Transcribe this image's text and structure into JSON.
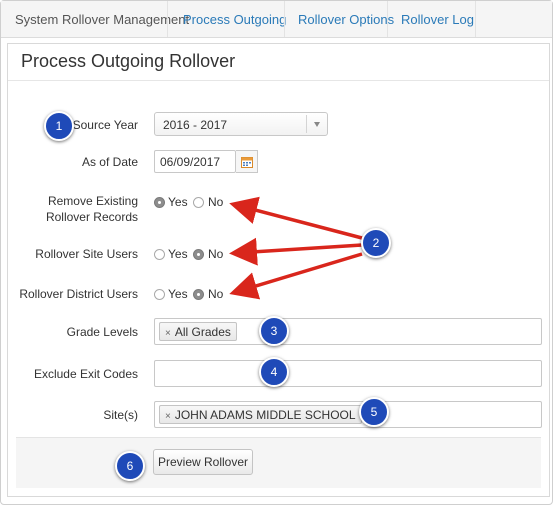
{
  "nav": {
    "title": "System Rollover Management",
    "tabs": [
      "Process Outgoing",
      "Rollover Options",
      "Rollover Log"
    ]
  },
  "page": {
    "title": "Process Outgoing Rollover"
  },
  "form": {
    "source_year": {
      "label": "Source Year",
      "value": "2016 - 2017"
    },
    "as_of_date": {
      "label": "As of Date",
      "value": "06/09/2017"
    },
    "remove_existing": {
      "label_line1": "Remove Existing",
      "label_line2": "Rollover Records",
      "yes": "Yes",
      "no": "No",
      "selected": "Yes"
    },
    "rollover_site_users": {
      "label": "Rollover Site Users",
      "yes": "Yes",
      "no": "No",
      "selected": "No"
    },
    "rollover_district_users": {
      "label": "Rollover District Users",
      "yes": "Yes",
      "no": "No",
      "selected": "No"
    },
    "grade_levels": {
      "label": "Grade Levels",
      "chips": [
        "All Grades"
      ]
    },
    "exclude_exit_codes": {
      "label": "Exclude Exit Codes",
      "chips": []
    },
    "sites": {
      "label": "Site(s)",
      "chips": [
        "JOHN ADAMS MIDDLE SCHOOL"
      ]
    }
  },
  "footer": {
    "preview_button": "Preview Rollover"
  },
  "annotations": {
    "badges": [
      "1",
      "2",
      "3",
      "4",
      "5",
      "6"
    ],
    "badge_color": "#1f4ab8",
    "arrow_color": "#d9261c"
  },
  "colors": {
    "link": "#2a7ab8",
    "nav_bg": "#f5f5f5"
  },
  "icons": {
    "chip_remove": "×",
    "calendar": "calendar-icon",
    "select_arrow": "chevron-down-icon"
  }
}
